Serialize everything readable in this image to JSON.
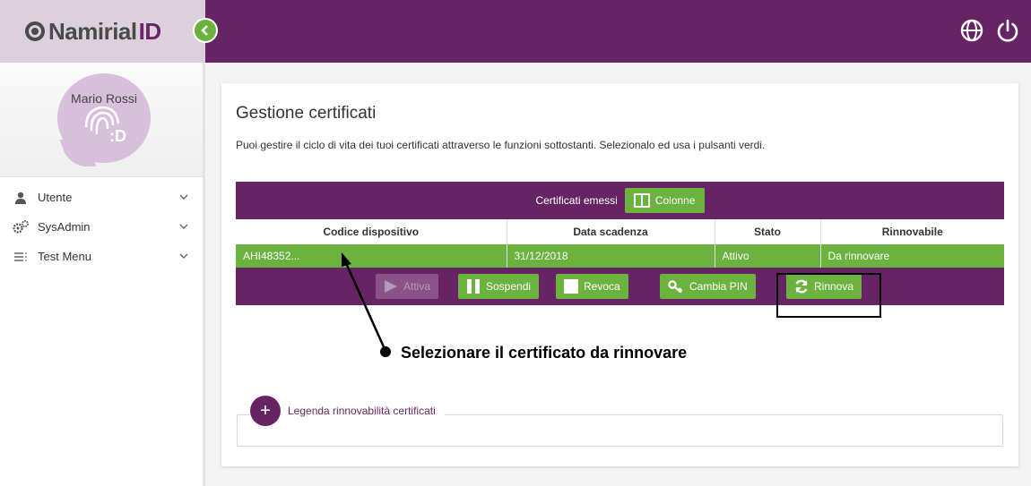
{
  "brand": {
    "name": "Namirial",
    "suffix": "ID"
  },
  "sidebar": {
    "user_name": "Mario Rossi",
    "items": [
      {
        "label": "Utente",
        "icon": "user-icon"
      },
      {
        "label": "SysAdmin",
        "icon": "gears-icon"
      },
      {
        "label": "Test Menu",
        "icon": "menu-list-icon"
      }
    ]
  },
  "header": {
    "icons": [
      "globe-icon",
      "power-icon"
    ]
  },
  "main": {
    "title": "Gestione certificati",
    "description": "Puoi gestire il ciclo di vita dei tuoi certificati attraverso le funzioni sottostanti. Selezionalo ed usa i pulsanti verdi.",
    "table": {
      "caption": "Certificati emessi",
      "columns_button": "Colonne",
      "headers": [
        "Codice dispositivo",
        "Data scadenza",
        "Stato",
        "Rinnovabile"
      ],
      "rows": [
        [
          "AHI48352...",
          "31/12/2018",
          "Attivo",
          "Da rinnovare"
        ]
      ]
    },
    "actions": {
      "attiva": "Attiva",
      "sospendi": "Sospendi",
      "revoca": "Revoca",
      "cambia_pin": "Cambia PIN",
      "rinnova": "Rinnova"
    },
    "annotation": "Selezionare il certificato da rinnovare",
    "legend": "Legenda rinnovabilità certificati"
  },
  "colors": {
    "primary": "#662465",
    "accent": "#6bb33e",
    "brand_bg": "#ddd0dd"
  }
}
